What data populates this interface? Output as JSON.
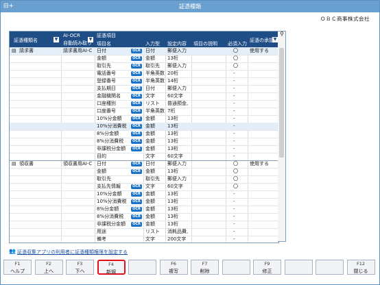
{
  "window": {
    "title": "証憑種類",
    "company": "ＯＢＣ商事株式会社"
  },
  "header": {
    "doc_type": "証憑種類名",
    "ai_ocr_1": "AI-OCR",
    "ai_ocr_2": "自動読み取り",
    "items_group": "証憑項目",
    "item_name": "項目名",
    "input_type": "入力型",
    "settings": "設定内容",
    "description": "項目の説明",
    "required": "必須入力",
    "approval": "証憑の承認"
  },
  "ocr_badge": "OCR",
  "rows": [
    {
      "doc": "請求書",
      "ai": "請求書用AI-C",
      "item": "日付",
      "ocr": true,
      "type": "日付",
      "setting": "郵便入力",
      "req": "〇",
      "approve": "使用する",
      "cls": "sel",
      "doc_icon": true
    },
    {
      "doc": "",
      "ai": "",
      "item": "金額",
      "ocr": true,
      "type": "金額",
      "setting": "13桁",
      "req": "〇",
      "approve": "",
      "cls": ""
    },
    {
      "doc": "",
      "ai": "",
      "item": "取引先",
      "ocr": true,
      "type": "取引先",
      "setting": "郵便入力",
      "req": "〇",
      "approve": "",
      "cls": ""
    },
    {
      "doc": "",
      "ai": "",
      "item": "電話番号",
      "ocr": true,
      "type": "半角英数",
      "setting": "20桁",
      "req": "-",
      "approve": "",
      "cls": ""
    },
    {
      "doc": "",
      "ai": "",
      "item": "登録番号",
      "ocr": true,
      "type": "半角英数",
      "setting": "14桁",
      "req": "-",
      "approve": "",
      "cls": ""
    },
    {
      "doc": "",
      "ai": "",
      "item": "支払期日",
      "ocr": true,
      "type": "日付",
      "setting": "郵便入力",
      "req": "-",
      "approve": "",
      "cls": ""
    },
    {
      "doc": "",
      "ai": "",
      "item": "金融機関名",
      "ocr": true,
      "type": "文字",
      "setting": "60文字",
      "req": "-",
      "approve": "",
      "cls": ""
    },
    {
      "doc": "",
      "ai": "",
      "item": "口座種別",
      "ocr": true,
      "type": "リスト",
      "setting": "普通預金,",
      "req": "-",
      "approve": "",
      "cls": ""
    },
    {
      "doc": "",
      "ai": "",
      "item": "口座番号",
      "ocr": true,
      "type": "半角英数",
      "setting": "7桁",
      "req": "-",
      "approve": "",
      "cls": ""
    },
    {
      "doc": "",
      "ai": "",
      "item": "10%分金額",
      "ocr": true,
      "type": "金額",
      "setting": "13桁",
      "req": "-",
      "approve": "",
      "cls": ""
    },
    {
      "doc": "",
      "ai": "",
      "item": "10%分消費税",
      "ocr": true,
      "type": "金額",
      "setting": "13桁",
      "req": "-",
      "approve": "",
      "cls": "sel"
    },
    {
      "doc": "",
      "ai": "",
      "item": "8%分金額",
      "ocr": true,
      "type": "金額",
      "setting": "13桁",
      "req": "-",
      "approve": "",
      "cls": ""
    },
    {
      "doc": "",
      "ai": "",
      "item": "8%分消費税",
      "ocr": true,
      "type": "金額",
      "setting": "13桁",
      "req": "-",
      "approve": "",
      "cls": ""
    },
    {
      "doc": "",
      "ai": "",
      "item": "非課税分金額",
      "ocr": true,
      "type": "金額",
      "setting": "13桁",
      "req": "-",
      "approve": "",
      "cls": ""
    },
    {
      "doc": "",
      "ai": "",
      "item": "目的",
      "ocr": false,
      "type": "文字",
      "setting": "60文字",
      "req": "-",
      "approve": "",
      "cls": "grpend"
    },
    {
      "doc": "領収書",
      "ai": "領収書用AI-C",
      "item": "日付",
      "ocr": true,
      "type": "日付",
      "setting": "郵便入力",
      "req": "〇",
      "approve": "使用する",
      "cls": "",
      "doc_icon": true
    },
    {
      "doc": "",
      "ai": "",
      "item": "金額",
      "ocr": true,
      "type": "金額",
      "setting": "13桁",
      "req": "〇",
      "approve": "",
      "cls": ""
    },
    {
      "doc": "",
      "ai": "",
      "item": "取引先",
      "ocr": false,
      "type": "取引先",
      "setting": "郵便入力",
      "req": "〇",
      "approve": "",
      "cls": ""
    },
    {
      "doc": "",
      "ai": "",
      "item": "支払先情報",
      "ocr": true,
      "type": "文字",
      "setting": "60文字",
      "req": "〇",
      "approve": "",
      "cls": ""
    },
    {
      "doc": "",
      "ai": "",
      "item": "10%分金額",
      "ocr": true,
      "type": "金額",
      "setting": "13桁",
      "req": "-",
      "approve": "",
      "cls": ""
    },
    {
      "doc": "",
      "ai": "",
      "item": "10%分消費税",
      "ocr": true,
      "type": "金額",
      "setting": "13桁",
      "req": "-",
      "approve": "",
      "cls": ""
    },
    {
      "doc": "",
      "ai": "",
      "item": "8%分金額",
      "ocr": true,
      "type": "金額",
      "setting": "13桁",
      "req": "-",
      "approve": "",
      "cls": ""
    },
    {
      "doc": "",
      "ai": "",
      "item": "8%分消費税",
      "ocr": true,
      "type": "金額",
      "setting": "13桁",
      "req": "-",
      "approve": "",
      "cls": ""
    },
    {
      "doc": "",
      "ai": "",
      "item": "非課税分金額",
      "ocr": true,
      "type": "金額",
      "setting": "13桁",
      "req": "-",
      "approve": "",
      "cls": ""
    },
    {
      "doc": "",
      "ai": "",
      "item": "用途",
      "ocr": false,
      "type": "リスト",
      "setting": "消耗品費,",
      "req": "-",
      "approve": "",
      "cls": ""
    },
    {
      "doc": "",
      "ai": "",
      "item": "備考",
      "ocr": false,
      "type": "文字",
      "setting": "200文字",
      "req": "-",
      "approve": "",
      "cls": ""
    }
  ],
  "link": {
    "text": "証憑収集アプリの利用者に証憑種類権限を設定する"
  },
  "fkeys": [
    {
      "key": "F1",
      "label": "ヘルプ"
    },
    {
      "key": "F2",
      "label": "上へ"
    },
    {
      "key": "F3",
      "label": "下へ"
    },
    {
      "key": "F4",
      "label": "新規",
      "selected": true
    },
    {
      "key": "",
      "label": ""
    },
    {
      "key": "F6",
      "label": "複写"
    },
    {
      "key": "F7",
      "label": "削除"
    },
    {
      "key": "",
      "label": ""
    },
    {
      "key": "F9",
      "label": "修正"
    },
    {
      "key": "",
      "label": ""
    },
    {
      "key": "",
      "label": ""
    },
    {
      "key": "F12",
      "label": "閉じる"
    }
  ],
  "colors": {
    "titlebar": "#6aa0cf",
    "header": "#1f4d86",
    "ocr_badge": "#1a72c9",
    "selection_border": "#e0101a"
  }
}
